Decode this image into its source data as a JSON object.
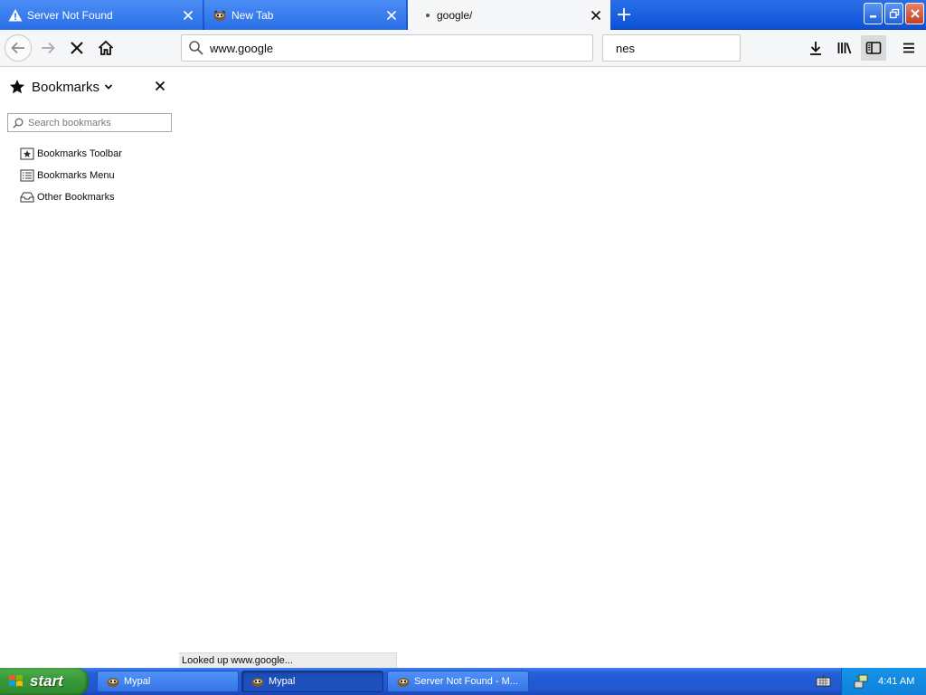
{
  "tabs": [
    {
      "title": "Server Not Found",
      "icon": "warning-icon",
      "state": "inactive"
    },
    {
      "title": "New Tab",
      "icon": "mypal-icon",
      "state": "inactive"
    },
    {
      "title": "google/",
      "icon": "loading-dot-icon",
      "state": "active"
    }
  ],
  "navbar": {
    "url_value": "www.google",
    "search_value": "nes"
  },
  "sidebar": {
    "title": "Bookmarks",
    "search_placeholder": "Search bookmarks",
    "items": [
      {
        "label": "Bookmarks Toolbar",
        "icon": "bookmarks-toolbar-icon"
      },
      {
        "label": "Bookmarks Menu",
        "icon": "bookmarks-menu-icon"
      },
      {
        "label": "Other Bookmarks",
        "icon": "other-bookmarks-icon"
      }
    ]
  },
  "status_text": "Looked up www.google...",
  "taskbar": {
    "start_label": "start",
    "tasks": [
      {
        "label": "Mypal",
        "active": false
      },
      {
        "label": "Mypal",
        "active": true
      },
      {
        "label": "Server Not Found - M...",
        "active": false
      }
    ],
    "clock": "4:41 AM"
  },
  "colors": {
    "titlebar_blue": "#0d51d6",
    "toolbar_bg": "#f5f6f7",
    "taskbar_blue": "#245ed8",
    "start_green": "#3a9a3a",
    "close_red": "#c24022"
  }
}
